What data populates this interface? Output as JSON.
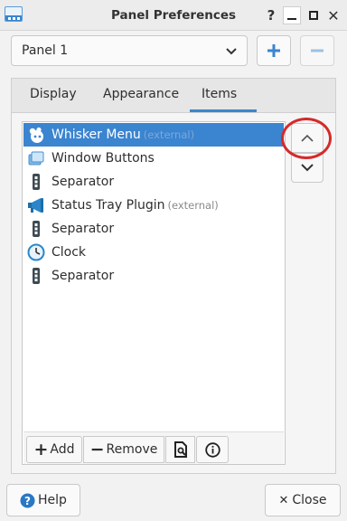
{
  "window": {
    "title": "Panel Preferences",
    "controls": {
      "help": "?",
      "close": "✕"
    }
  },
  "panel_selector": {
    "selected": "Panel 1"
  },
  "tabs": [
    {
      "label": "Display"
    },
    {
      "label": "Appearance"
    },
    {
      "label": "Items"
    }
  ],
  "active_tab": "Items",
  "items": [
    {
      "name": "Whisker Menu",
      "tag": "(external)",
      "icon": "whisker-menu-icon",
      "selected": true
    },
    {
      "name": "Window Buttons",
      "tag": "",
      "icon": "window-buttons-icon",
      "selected": false
    },
    {
      "name": "Separator",
      "tag": "",
      "icon": "separator-icon",
      "selected": false
    },
    {
      "name": "Status Tray Plugin",
      "tag": "(external)",
      "icon": "megaphone-icon",
      "selected": false
    },
    {
      "name": "Separator",
      "tag": "",
      "icon": "separator-icon",
      "selected": false
    },
    {
      "name": "Clock",
      "tag": "",
      "icon": "clock-icon",
      "selected": false
    },
    {
      "name": "Separator",
      "tag": "",
      "icon": "separator-icon",
      "selected": false
    }
  ],
  "list_toolbar": {
    "add_label": "Add",
    "remove_label": "Remove"
  },
  "footer": {
    "help_label": "Help",
    "close_label": "Close",
    "close_glyph": "✕"
  },
  "colors": {
    "selection": "#3b84d0",
    "accent": "#3a86cf",
    "highlight_ring": "#d42a2a"
  }
}
